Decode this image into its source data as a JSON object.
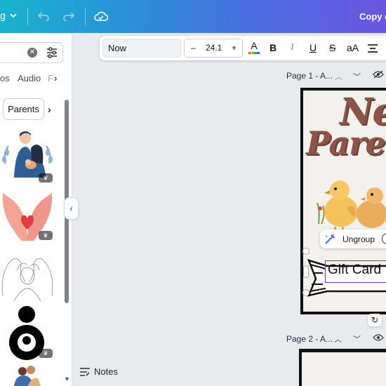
{
  "topbar": {
    "menu_label": "g",
    "title": "Copy o"
  },
  "leftpanel": {
    "tabs": [
      "os",
      "Audio",
      "F"
    ],
    "filter_chip": "Parents"
  },
  "toolbar": {
    "font": "Now",
    "size_minus": "–",
    "font_size": "24.1",
    "size_plus": "+",
    "text_color_letter": "A",
    "bold": "B",
    "italic": "I",
    "underline": "U",
    "strike": "S",
    "case": "aA",
    "text_color": "#7d2ae8"
  },
  "canvas": {
    "page1_label": "Page 1 - A...",
    "page2_label": "Page 2 - A...",
    "design_title_line1": "Ne",
    "design_title_line2": "Pare",
    "ungroup_label": "Ungroup",
    "gift_card_text": "Gift Card"
  },
  "footer": {
    "notes_label": "Notes"
  },
  "colors": {
    "accent": "#7d2ae8",
    "title_brown": "#8e5547"
  }
}
